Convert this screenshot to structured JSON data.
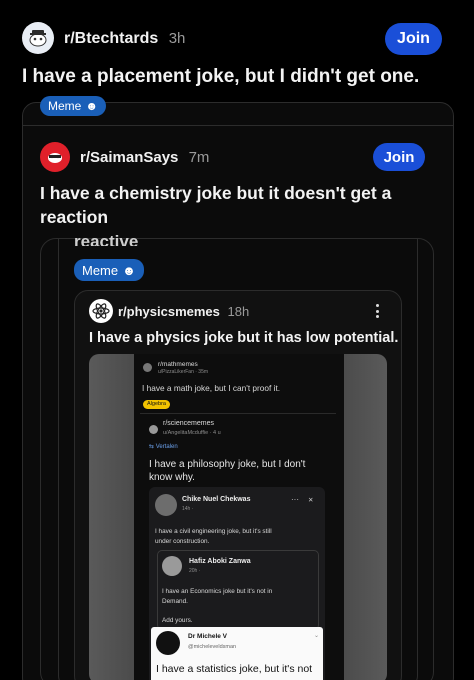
{
  "post1": {
    "subreddit": "r/Btechtards",
    "time": "3h",
    "join": "Join",
    "title": "I have a placement joke, but I didn't get one.",
    "flair": "Meme"
  },
  "post2": {
    "subreddit": "r/SaimanSays",
    "time": "7m",
    "join": "Join",
    "title_line1": "I have a chemistry joke but it doesn't get a",
    "title_line2": "reaction",
    "cutoff_text": "reactive",
    "flair": "Meme"
  },
  "post3": {
    "subreddit": "r/physicsmemes",
    "time": "18h",
    "title": "I have a physics joke but it has low potential."
  },
  "inner": {
    "math_sub": "r/mathmemes",
    "math_user": "u/PizzaLikerFan · 35m",
    "math_title": "I have a math joke, but I can't proof it.",
    "math_flair": "Algebra",
    "sci_sub": "r/sciencememes",
    "sci_user": "u/AngelitaMcduffie · 4 u",
    "translate": "Vertalen",
    "philo_line1": "I have a philosophy joke, but I don't",
    "philo_line2": "know why.",
    "fb_name": "Chike Nuel Chekwas",
    "fb_meta": "14h · ",
    "fb_dots": "···",
    "fb_close": "✕",
    "civil_line1": "I have a civil engineering joke, but it's still",
    "civil_line2": "under construction.",
    "hafiz_name": "Hafiz Aboki Zanwa",
    "hafiz_meta": "20h · ",
    "econ_line1": "I have an Economics joke but it's not in",
    "econ_line2": "Demand.",
    "add_yours": "Add yours.",
    "dr_name": "Dr Michele V",
    "dr_handle": "@micheleveldsman",
    "stats_line": "I have a statistics joke, but it's not"
  },
  "colors": {
    "join_blue": "#1a4fd8",
    "flair_blue": "#1a5fb8",
    "algebra_yellow": "#f2c300"
  }
}
